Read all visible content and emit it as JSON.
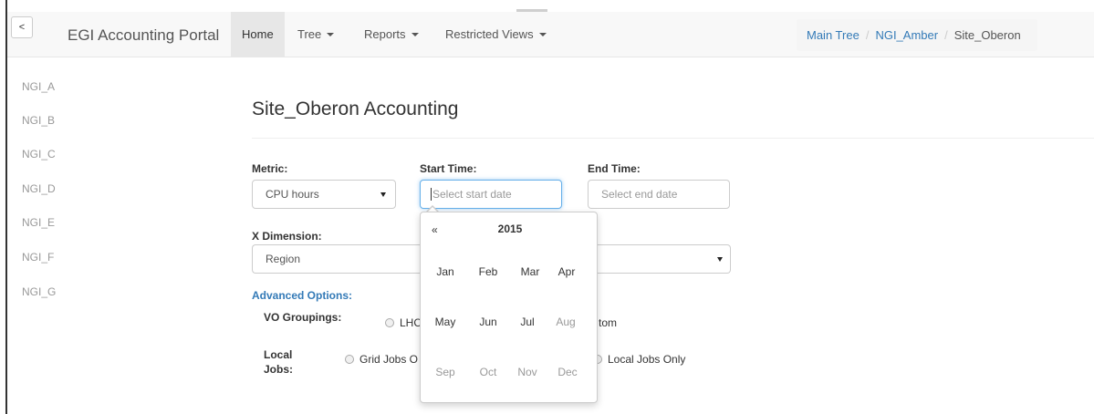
{
  "nav": {
    "collapse_label": "<",
    "brand": "EGI Accounting Portal",
    "items": [
      {
        "label": "Home",
        "active": true,
        "dropdown": false
      },
      {
        "label": "Tree",
        "active": false,
        "dropdown": true
      },
      {
        "label": "Reports",
        "active": false,
        "dropdown": true
      },
      {
        "label": "Restricted Views",
        "active": false,
        "dropdown": true
      }
    ]
  },
  "breadcrumb": {
    "items": [
      "Main Tree",
      "NGI_Amber"
    ],
    "current": "Site_Oberon"
  },
  "sidebar": {
    "items": [
      "NGI_A",
      "NGI_B",
      "NGI_C",
      "NGI_D",
      "NGI_E",
      "NGI_F",
      "NGI_G"
    ]
  },
  "main": {
    "title": "Site_Oberon Accounting",
    "metric": {
      "label": "Metric:",
      "value": "CPU hours"
    },
    "start_time": {
      "label": "Start Time:",
      "placeholder": "Select start date"
    },
    "end_time": {
      "label": "End Time:",
      "placeholder": "Select end date"
    },
    "x_dimension": {
      "label": "X Dimension:",
      "value": "Region"
    },
    "advanced_options": "Advanced Options:",
    "vo_groupings": {
      "label": "VO Groupings:",
      "option_lhc": "LHC",
      "option_custom_partial": "tom"
    },
    "local_jobs": {
      "label_line1": "Local",
      "label_line2": "Jobs:",
      "option_grid_partial": "Grid Jobs O",
      "option_local_only": "Local Jobs Only"
    }
  },
  "datepicker": {
    "prev": "«",
    "year": "2015",
    "months": [
      {
        "label": "Jan",
        "disabled": false
      },
      {
        "label": "Feb",
        "disabled": false
      },
      {
        "label": "Mar",
        "disabled": false
      },
      {
        "label": "Apr",
        "disabled": false
      },
      {
        "label": "May",
        "disabled": false
      },
      {
        "label": "Jun",
        "disabled": false
      },
      {
        "label": "Jul",
        "disabled": false
      },
      {
        "label": "Aug",
        "disabled": true
      },
      {
        "label": "Sep",
        "disabled": true
      },
      {
        "label": "Oct",
        "disabled": true
      },
      {
        "label": "Nov",
        "disabled": true
      },
      {
        "label": "Dec",
        "disabled": true
      }
    ]
  },
  "colors": {
    "link": "#337ab7",
    "navbar_bg": "#f8f8f8",
    "active_nav_bg": "#e7e7e7",
    "focus_border": "#66afe9"
  }
}
